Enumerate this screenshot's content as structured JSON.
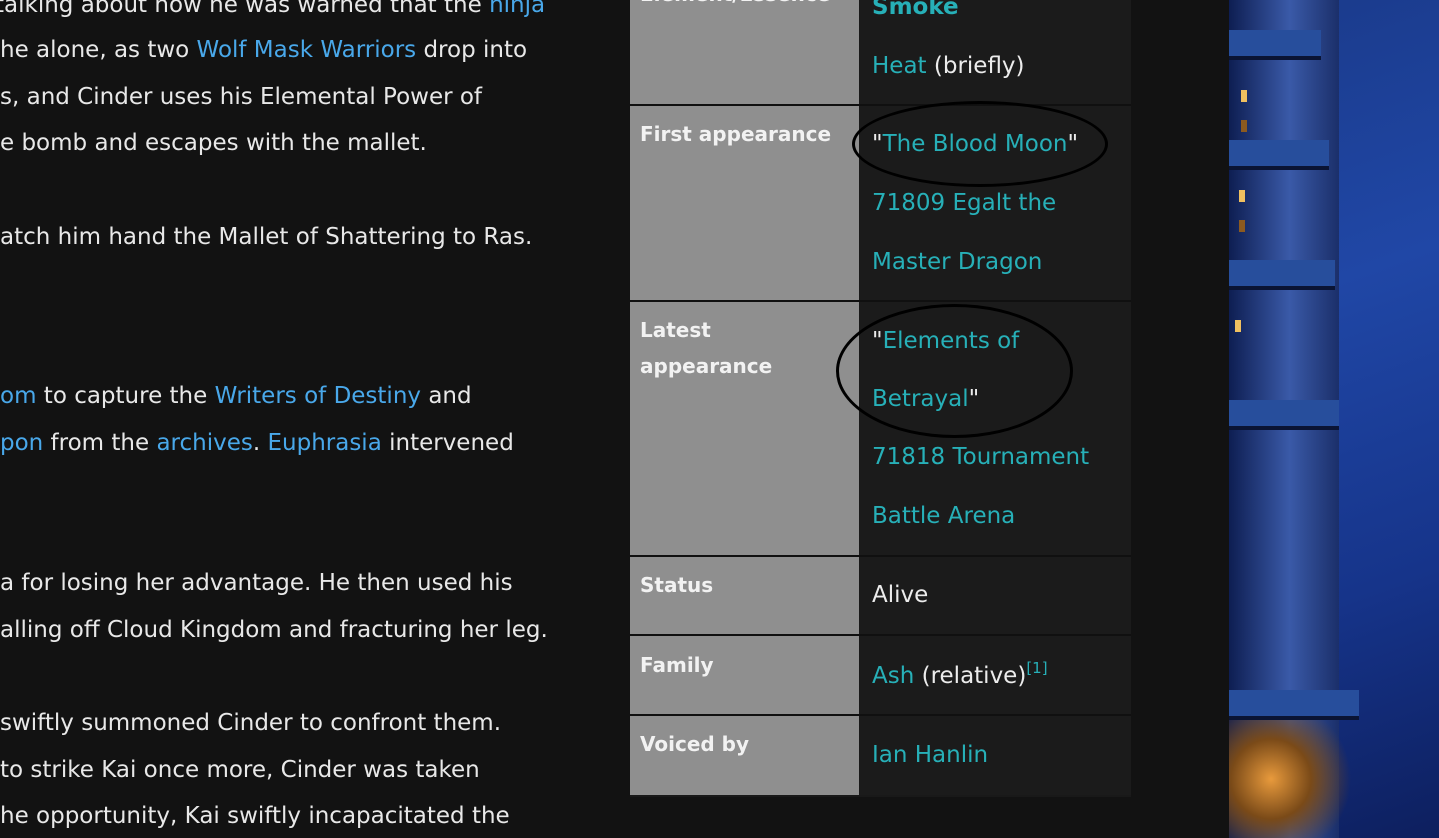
{
  "article": {
    "lines": [
      [
        {
          "t": "talking about how he was warned that the "
        },
        {
          "t": "ninja",
          "link": true
        }
      ],
      [
        {
          "t": "he alone, as two "
        },
        {
          "t": "Wolf Mask Warriors",
          "link": true
        },
        {
          "t": " drop into"
        }
      ],
      [
        {
          "t": "s, and Cinder uses his Elemental Power of"
        }
      ],
      [
        {
          "t": "e bomb and escapes with the mallet."
        }
      ],
      [
        {
          "t": "atch him hand the Mallet of Shattering to Ras."
        }
      ],
      [
        {
          "t": "om",
          "link": true
        },
        {
          "t": " to capture the "
        },
        {
          "t": "Writers of Destiny",
          "link": true
        },
        {
          "t": " and"
        }
      ],
      [
        {
          "t": "pon",
          "link": true
        },
        {
          "t": " from the "
        },
        {
          "t": "archives",
          "link": true
        },
        {
          "t": ". "
        },
        {
          "t": "Euphrasia",
          "link": true
        },
        {
          "t": " intervened"
        }
      ],
      [
        {
          "t": "a for losing her advantage. He then used his"
        }
      ],
      [
        {
          "t": "alling off Cloud Kingdom and fracturing her leg."
        }
      ],
      [
        {
          "t": "swiftly summoned Cinder to confront them."
        }
      ],
      [
        {
          "t": "to strike Kai once more, Cinder was taken"
        }
      ],
      [
        {
          "t": "he opportunity, Kai swiftly incapacitated the"
        }
      ]
    ]
  },
  "infobox": {
    "element_label": "Element/Essence",
    "element_values": [
      "Smoke",
      "Heat"
    ],
    "element_note": " (briefly)",
    "first_label": "First appearance",
    "first_episode": "The Blood Moon",
    "first_set": [
      "71809 Egalt the",
      "Master Dragon"
    ],
    "latest_label": [
      "Latest",
      "appearance"
    ],
    "latest_episode": [
      "Elements of",
      "Betrayal"
    ],
    "latest_set": [
      "71818 Tournament",
      "Battle Arena"
    ],
    "status_label": "Status",
    "status_value": "Alive",
    "family_label": "Family",
    "family_link": "Ash",
    "family_note": " (relative)",
    "family_ref": "[1]",
    "voiced_label": "Voiced by",
    "voiced_value": "Ian Hanlin",
    "quote_open": "\"",
    "quote_close": "\""
  },
  "colors": {
    "page_bg": "#121212",
    "article_link": "#49a8ea",
    "infobox_link": "#27b0b8",
    "label_bg": "#8f8f8f"
  }
}
